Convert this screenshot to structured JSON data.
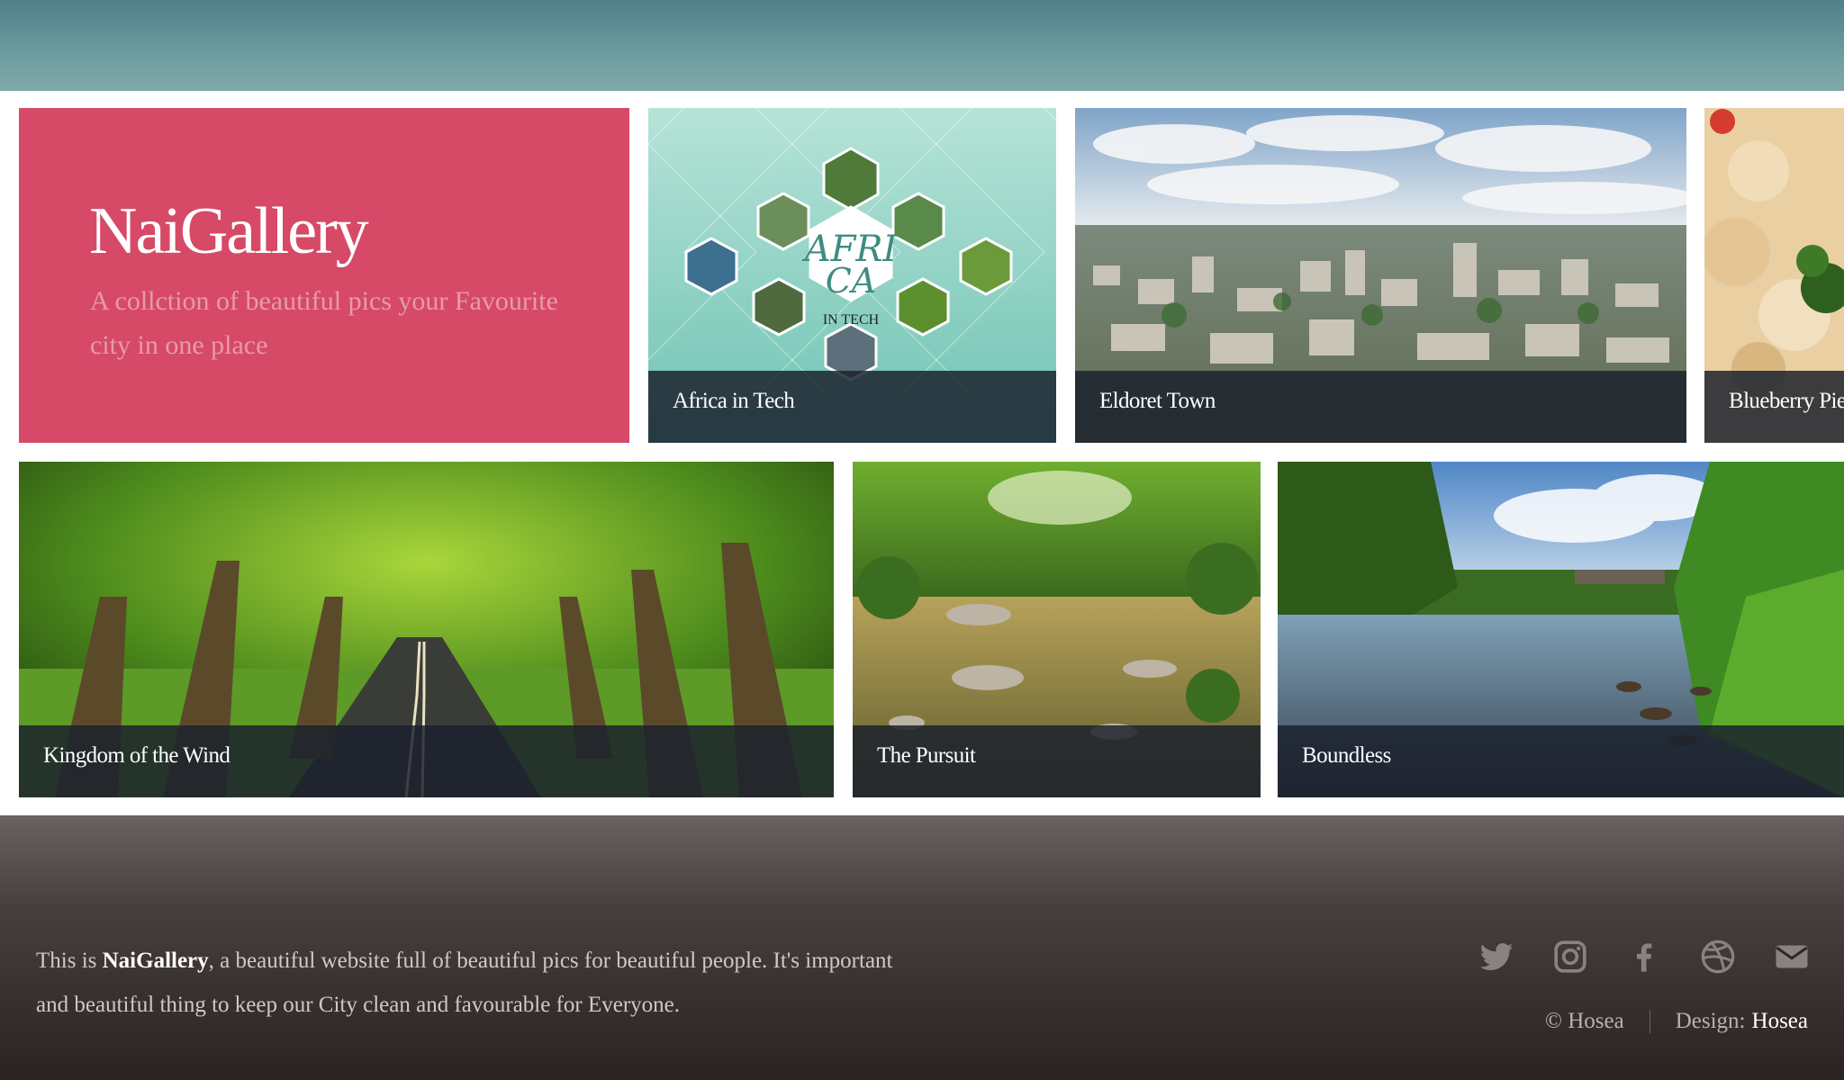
{
  "intro": {
    "title": "NaiGallery",
    "subtitle": "A collction of beautiful pics your Favourite city in one place"
  },
  "gallery": {
    "tiles": [
      {
        "caption": "Africa in Tech",
        "logo_text_1": "AFRI",
        "logo_text_2": "CA",
        "logo_text_3": "IN TECH"
      },
      {
        "caption": "Eldoret Town"
      },
      {
        "caption": "Blueberry Pie"
      },
      {
        "caption": "Kingdom of the Wind"
      },
      {
        "caption": "The Pursuit"
      },
      {
        "caption": "Boundless"
      }
    ]
  },
  "footer": {
    "text_prefix": "This is ",
    "brand": "NaiGallery",
    "text_suffix": ", a beautiful website full of beautiful pics for beautiful people. It's important and beautiful thing to keep our City clean and favourable for Everyone.",
    "copyright": "© Hosea",
    "design_label": "Design:",
    "design_author": "Hosea",
    "social_icons": [
      "twitter-icon",
      "instagram-icon",
      "facebook-icon",
      "dribbble-icon",
      "mail-icon"
    ]
  },
  "colors": {
    "intro_bg": "#d64a67",
    "caption_bar": "#1a202c",
    "footer_bg": "#2b2322",
    "top_band": "#6b9a9e"
  }
}
